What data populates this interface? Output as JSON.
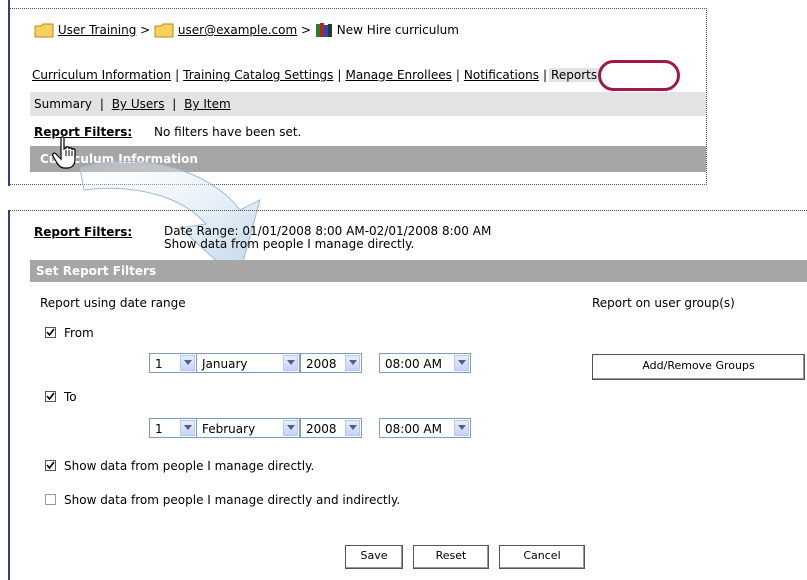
{
  "breadcrumb": {
    "item1": "User Training",
    "sep": ">",
    "item2": "user@example.com",
    "item3": "New Hire curriculum"
  },
  "tabs": {
    "curriculum_info": "Curriculum Information",
    "catalog_settings": "Training Catalog Settings",
    "manage_enrollees": "Manage Enrollees",
    "notifications": "Notifications",
    "reports": "Reports",
    "divider": "|"
  },
  "subnav": {
    "summary": "Summary",
    "by_users": "By Users",
    "by_item": "By Item"
  },
  "top_filters": {
    "label": "Report Filters:",
    "value": "No filters have been set."
  },
  "top_section_header": "Curriculum Information",
  "bottom_filters": {
    "label": "Report Filters:",
    "line1": "Date Range: 01/01/2008 8:00 AM-02/01/2008 8:00 AM",
    "line2": "Show data from people I manage directly."
  },
  "set_filters_header": "Set Report Filters",
  "date_range": {
    "heading": "Report using date range",
    "from_label": "From",
    "from_checked": true,
    "from_day": "1",
    "from_month": "January",
    "from_year": "2008",
    "from_time": "08:00 AM",
    "to_label": "To",
    "to_checked": true,
    "to_day": "1",
    "to_month": "February",
    "to_year": "2008",
    "to_time": "08:00 AM"
  },
  "user_group": {
    "heading": "Report on user group(s)",
    "button": "Add/Remove Groups"
  },
  "options": {
    "direct_label": "Show data from people I manage directly.",
    "direct_checked": true,
    "indirect_label": "Show data from people I manage directly and indirectly.",
    "indirect_checked": false
  },
  "actions": {
    "save": "Save",
    "reset": "Reset",
    "cancel": "Cancel"
  },
  "colors": {
    "highlight_oval": "#a0184a",
    "header_gray": "#a6a6a6",
    "subbar_gray": "#e3e3e3",
    "arrow_blue": "#c5d9ec"
  }
}
